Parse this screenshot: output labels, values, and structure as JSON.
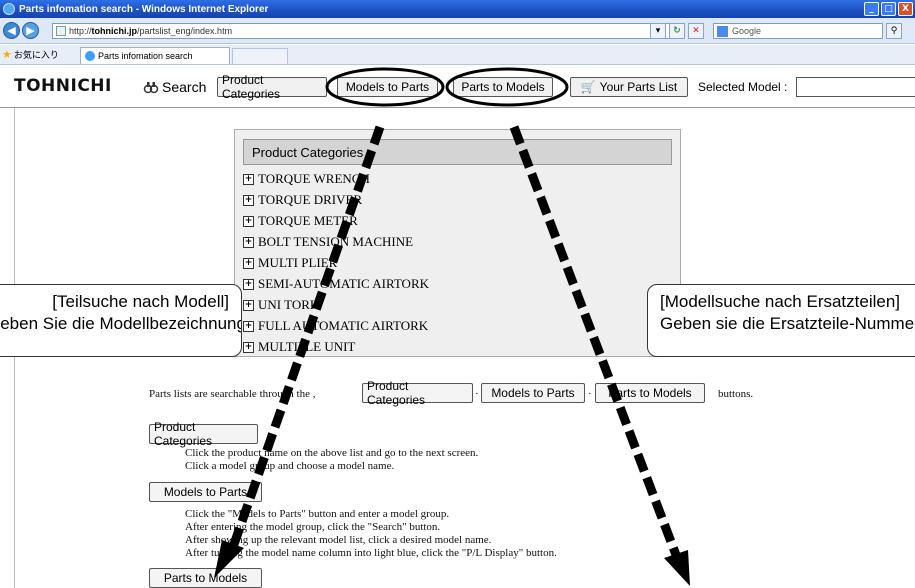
{
  "window": {
    "title": "Parts infomation search - Windows Internet Explorer",
    "min": "_",
    "max": "□",
    "close": "X"
  },
  "address": {
    "url_prefix": "http://",
    "url_host": "tohnichi.jp",
    "url_path": "/partslist_eng/index.htm",
    "search_engine": "Google"
  },
  "favorites": {
    "label": "お気に入り",
    "tab_title": "Parts infomation search"
  },
  "toolbar": {
    "logo": "TOHNICHI",
    "search_label": "Search",
    "btn_product_categories": "Product Categories",
    "btn_models_to_parts": "Models to Parts",
    "btn_parts_to_models": "Parts to Models",
    "btn_your_parts_list": "Your Parts List",
    "selected_model_label": "Selected Model :"
  },
  "panel": {
    "header": "Product Categories",
    "items": [
      "TORQUE WRENCH",
      "TORQUE DRIVER",
      "TORQUE METER",
      "BOLT TENSION MACHINE",
      "MULTI PLIER",
      "SEMI-AUTOMATIC AIRTORK",
      "UNI TORK",
      "FULL AUTOMATIC AIRTORK",
      "MULTIPLE UNIT"
    ]
  },
  "callouts": {
    "left_line1": "[Teilsuche nach Modell]",
    "left_line2": "Geben Sie die Modellbezeichnung ein",
    "right_line1": "[Modellsuche nach Ersatzteilen]",
    "right_line2": "Geben sie die Ersatzteile-Nummer ein"
  },
  "content": {
    "intro_prefix": "Parts lists are searchable through the ,",
    "intro_suffix": "buttons.",
    "btn_product_categories": "Product Categories",
    "btn_models_to_parts": "Models to Parts",
    "btn_parts_to_models": "Parts to Models",
    "pc_line1": "Click the product name on the above list and go to the next screen.",
    "pc_line2": "Click a model group and choose a model name.",
    "mp_line1": "Click the \"Models to Parts\" button and enter a model group.",
    "mp_line2": "After entering the model group, click the \"Search\" button.",
    "mp_line3": "After showing up the relevant model list, click a desired model name.",
    "mp_line4": "After turning the model name column into light blue, click the \"P/L Display\" button."
  }
}
